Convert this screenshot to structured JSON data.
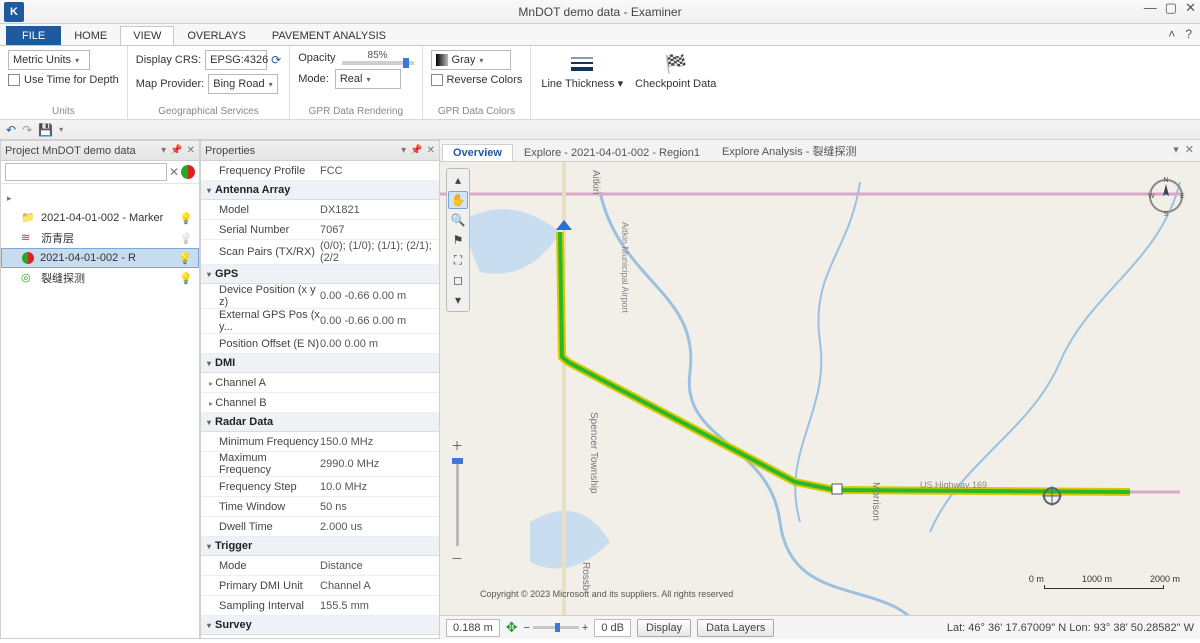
{
  "title": "MnDOT demo data - Examiner",
  "ribbon_tabs": {
    "file": "FILE",
    "home": "HOME",
    "view": "VIEW",
    "overlays": "OVERLAYS",
    "pavement": "PAVEMENT ANALYSIS"
  },
  "ribbon": {
    "units_dd": "Metric Units",
    "use_time": "Use Time for Depth",
    "group_units": "Units",
    "display_crs_label": "Display CRS:",
    "display_crs": "EPSG:4326",
    "map_provider_label": "Map Provider:",
    "map_provider": "Bing Road",
    "group_geo": "Geographical Services",
    "opacity_label": "Opacity",
    "opacity_value": "85%",
    "mode_label": "Mode:",
    "mode": "Real",
    "group_gpr_render": "GPR Data Rendering",
    "palette": "Gray",
    "reverse_colors": "Reverse Colors",
    "group_gpr_colors": "GPR Data Colors",
    "line_thickness": "Line Thickness",
    "checkpoint": "Checkpoint Data"
  },
  "project": {
    "panel_title": "Project MnDOT demo data",
    "items": {
      "a": "2021-04-01-002 - Marker",
      "b": "沥青层",
      "c": "2021-04-01-002 - R",
      "d": "裂缝探测"
    }
  },
  "props": {
    "panel_title": "Properties",
    "freq_profile_k": "Frequency Profile",
    "freq_profile_v": "FCC",
    "sect_antenna": "Antenna Array",
    "model_k": "Model",
    "model_v": "DX1821",
    "serial_k": "Serial Number",
    "serial_v": "7067",
    "scanpairs_k": "Scan Pairs (TX/RX)",
    "scanpairs_v": "(0/0); (1/0); (1/1); (2/1); (2/2",
    "sect_gps": "GPS",
    "devpos_k": "Device Position (x y z)",
    "devpos_v": "0.00 -0.66 0.00 m",
    "extgps_k": "External GPS Pos (x y...",
    "extgps_v": "0.00 -0.66 0.00 m",
    "posoff_k": "Position Offset (E N)",
    "posoff_v": "0.00 0.00 m",
    "sect_dmi": "DMI",
    "chA": "Channel A",
    "chB": "Channel B",
    "sect_radar": "Radar Data",
    "minf_k": "Minimum Frequency",
    "minf_v": "150.0 MHz",
    "maxf_k": "Maximum Frequency",
    "maxf_v": "2990.0 MHz",
    "fstep_k": "Frequency Step",
    "fstep_v": "10.0 MHz",
    "twin_k": "Time Window",
    "twin_v": "50 ns",
    "dwell_k": "Dwell Time",
    "dwell_v": "2.000 us",
    "sect_trigger": "Trigger",
    "tmode_k": "Mode",
    "tmode_v": "Distance",
    "pdmi_k": "Primary DMI Unit",
    "pdmi_v": "Channel A",
    "sampi_k": "Sampling Interval",
    "sampi_v": "155.5 mm",
    "sect_survey": "Survey"
  },
  "map_tabs": {
    "overview": "Overview",
    "explore": "Explore - 2021-04-01-002 - Region1",
    "analysis": "Explore Analysis - 裂缝探测"
  },
  "map": {
    "copyright": "Copyright © 2023 Microsoft and its suppliers. All rights reserved",
    "scale": {
      "a": "0 m",
      "b": "1000 m",
      "c": "2000 m"
    },
    "labels": {
      "aitkin": "Aitkin",
      "airport": "Aitkin Municipal Airport",
      "spencer": "Spencer Township",
      "rossb": "Rossb",
      "morr": "Morrison",
      "hwy": "US Highway 169"
    }
  },
  "bottom": {
    "dist": "0.188 m",
    "db": "0 dB",
    "display": "Display",
    "layers": "Data Layers",
    "latlon": "Lat: 46° 36' 17.67009\" N Lon: 93° 38' 50.28582\" W"
  }
}
